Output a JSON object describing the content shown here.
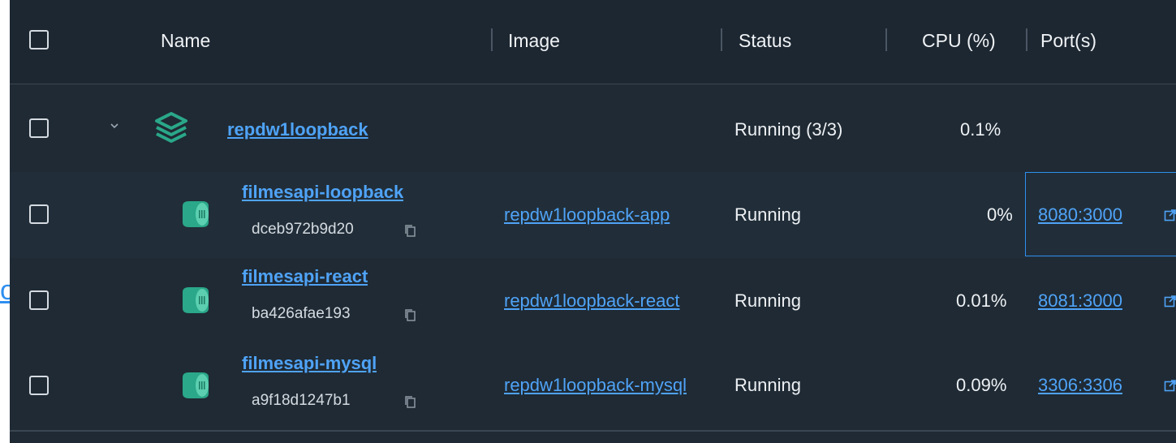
{
  "columns": {
    "name": "Name",
    "image": "Image",
    "status": "Status",
    "cpu": "CPU (%)",
    "ports": "Port(s)"
  },
  "edge_link": "o",
  "group": {
    "name": "repdw1loopback",
    "status": "Running (3/3)",
    "cpu": "0.1%"
  },
  "containers": [
    {
      "name": "filmesapi-loopback",
      "id": "dceb972b9d20",
      "image": "repdw1loopback-app",
      "status": "Running",
      "cpu": "0%",
      "port": "8080:3000"
    },
    {
      "name": "filmesapi-react",
      "id": "ba426afae193",
      "image": "repdw1loopback-react",
      "status": "Running",
      "cpu": "0.01%",
      "port": "8081:3000"
    },
    {
      "name": "filmesapi-mysql",
      "id": "a9f18d1247b1",
      "image": "repdw1loopback-mysql",
      "status": "Running",
      "cpu": "0.09%",
      "port": "3306:3306"
    }
  ],
  "colors": {
    "background": "#1f2a34",
    "link": "#4fa3f7",
    "icon_teal": "#2aa889",
    "focus_border": "#2f8ff0"
  }
}
